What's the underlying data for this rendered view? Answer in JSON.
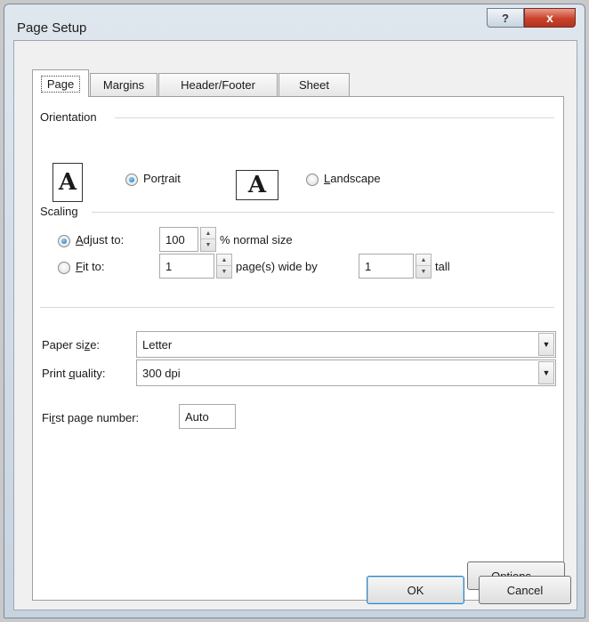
{
  "window": {
    "title": "Page Setup",
    "help_label": "?",
    "close_label": "x"
  },
  "tabs": [
    {
      "label": "Page",
      "active": true
    },
    {
      "label": "Margins",
      "active": false
    },
    {
      "label": "Header/Footer",
      "active": false
    },
    {
      "label": "Sheet",
      "active": false
    }
  ],
  "orientation": {
    "group_label": "Orientation",
    "icon_glyph": "A",
    "portrait": {
      "label_pre": "Por",
      "label_mnemonic": "t",
      "label_post": "rait",
      "checked": true
    },
    "landscape": {
      "label_pre": "",
      "label_mnemonic": "L",
      "label_post": "andscape",
      "checked": false
    }
  },
  "scaling": {
    "group_label": "Scaling",
    "adjust": {
      "label_pre": "",
      "label_mnemonic": "A",
      "label_post": "djust to:",
      "value": "100",
      "suffix": "% normal size",
      "checked": true
    },
    "fit": {
      "label_pre": "",
      "label_mnemonic": "F",
      "label_post": "it to:",
      "wide_value": "1",
      "wide_suffix": "page(s) wide by",
      "tall_value": "1",
      "tall_suffix": "tall",
      "checked": false
    }
  },
  "paper_size": {
    "label_pre": "Paper si",
    "label_mnemonic": "z",
    "label_post": "e:",
    "value": "Letter"
  },
  "print_quality": {
    "label_pre": "Print ",
    "label_mnemonic": "q",
    "label_post": "uality:",
    "value": "300 dpi"
  },
  "first_page": {
    "label_pre": "Fi",
    "label_mnemonic": "r",
    "label_post": "st page number:",
    "value": "Auto"
  },
  "options_button": {
    "label_pre": "",
    "label_mnemonic": "O",
    "label_post": "ptions..."
  },
  "ok_label": "OK",
  "cancel_label": "Cancel",
  "spin_up": "▲",
  "spin_down": "▼",
  "dropdown_arrow": "▼"
}
